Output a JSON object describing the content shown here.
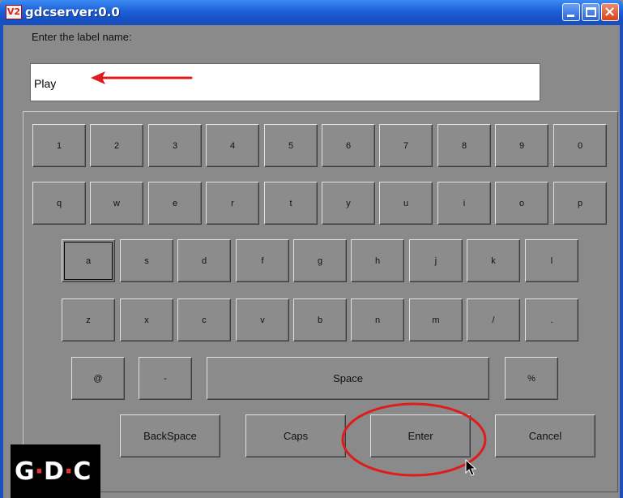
{
  "window": {
    "title": "gdcserver:0.0",
    "icon": "V2"
  },
  "prompt": "Enter the label name:",
  "label_field": {
    "value": "Play"
  },
  "keyboard": {
    "row1": [
      "1",
      "2",
      "3",
      "4",
      "5",
      "6",
      "7",
      "8",
      "9",
      "0"
    ],
    "row2": [
      "q",
      "w",
      "e",
      "r",
      "t",
      "y",
      "u",
      "i",
      "o",
      "p"
    ],
    "row3": [
      "a",
      "s",
      "d",
      "f",
      "g",
      "h",
      "j",
      "k",
      "l"
    ],
    "row4": [
      "z",
      "x",
      "c",
      "v",
      "b",
      "n",
      "m",
      "/",
      "."
    ],
    "at": "@",
    "dash": "-",
    "space": "Space",
    "percent": "%",
    "backspace": "BackSpace",
    "caps": "Caps",
    "enter": "Enter",
    "cancel": "Cancel"
  },
  "logo": {
    "g": "G",
    "d": "D",
    "c": "C",
    "dot": "·"
  },
  "colors": {
    "annotation_red": "#e01b1b",
    "titlebar": "#1d5fd6",
    "panel": "#8a8a8a"
  }
}
